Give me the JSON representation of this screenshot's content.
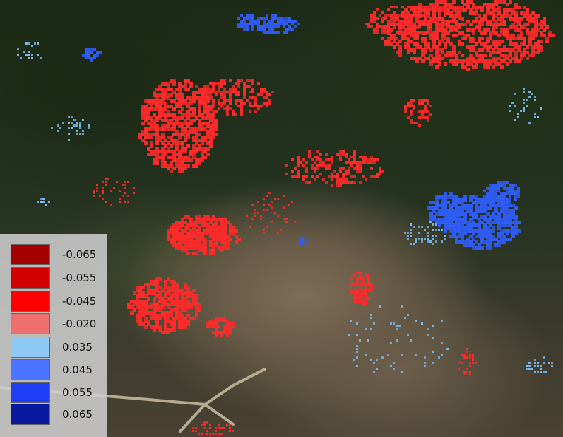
{
  "colors": {
    "red_series": "#ff2a2a",
    "light_blue_series": "#78b8f0",
    "blue_series": "#2f5cf5",
    "road": "#c9bfa3"
  },
  "legend": {
    "items": [
      {
        "label": "-0.065",
        "color": "#a50000"
      },
      {
        "label": "-0.055",
        "color": "#d20000"
      },
      {
        "label": "-0.045",
        "color": "#ff0000"
      },
      {
        "label": "-0.020",
        "color": "#ef6e6e"
      },
      {
        "label": "0.035",
        "color": "#8ec8f5"
      },
      {
        "label": "0.045",
        "color": "#4a74ff"
      },
      {
        "label": "0.055",
        "color": "#1f3df5"
      },
      {
        "label": "0.065",
        "color": "#0a1aa0"
      }
    ]
  }
}
